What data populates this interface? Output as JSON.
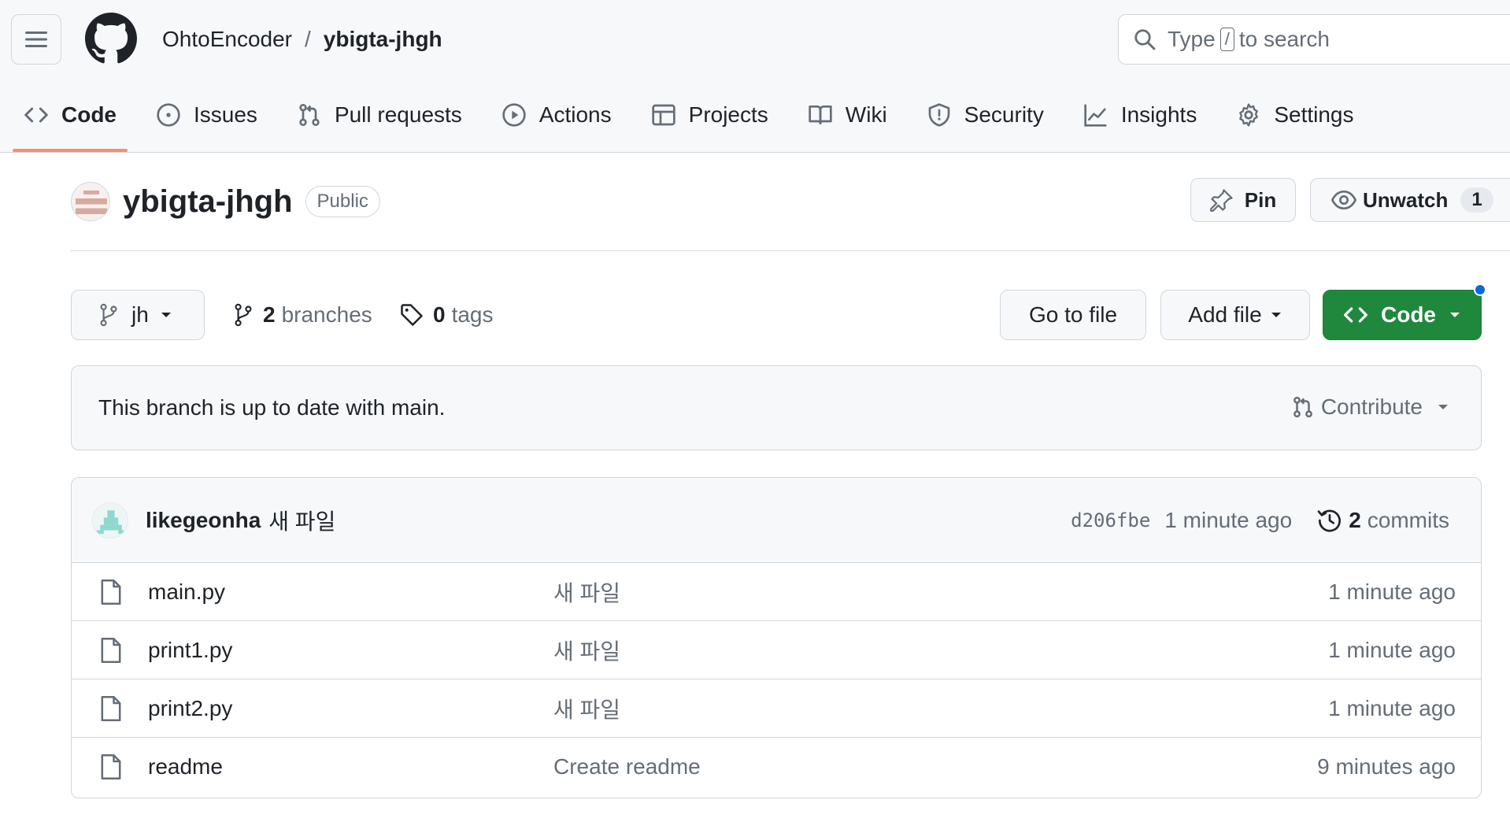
{
  "header": {
    "owner": "OhtoEncoder",
    "separator": "/",
    "repo": "ybigta-jhgh",
    "search": {
      "before": "Type",
      "key": "/",
      "after": "to search"
    }
  },
  "tabs": [
    {
      "label": "Code",
      "icon": "code-icon",
      "active": true
    },
    {
      "label": "Issues",
      "icon": "issue-opened-icon"
    },
    {
      "label": "Pull requests",
      "icon": "git-pull-request-icon"
    },
    {
      "label": "Actions",
      "icon": "play-icon"
    },
    {
      "label": "Projects",
      "icon": "table-icon"
    },
    {
      "label": "Wiki",
      "icon": "book-icon"
    },
    {
      "label": "Security",
      "icon": "shield-icon"
    },
    {
      "label": "Insights",
      "icon": "graph-icon"
    },
    {
      "label": "Settings",
      "icon": "gear-icon"
    }
  ],
  "repo": {
    "title": "ybigta-jhgh",
    "visibility": "Public",
    "pin_label": "Pin",
    "watch_label": "Unwatch",
    "watch_count": "1"
  },
  "branch_bar": {
    "current_branch": "jh",
    "branches_count": "2",
    "branches_label": "branches",
    "tags_count": "0",
    "tags_label": "tags",
    "go_to_file": "Go to file",
    "add_file": "Add file",
    "code_label": "Code"
  },
  "flash": {
    "message": "This branch is up to date with main.",
    "contribute_label": "Contribute"
  },
  "latest_commit": {
    "author": "likegeonha",
    "message": "새 파일",
    "sha": "d206fbe",
    "time": "1 minute ago",
    "commits_count": "2",
    "commits_label": "commits"
  },
  "files": [
    {
      "name": "main.py",
      "message": "새 파일",
      "time": "1 minute ago"
    },
    {
      "name": "print1.py",
      "message": "새 파일",
      "time": "1 minute ago"
    },
    {
      "name": "print2.py",
      "message": "새 파일",
      "time": "1 minute ago"
    },
    {
      "name": "readme",
      "message": "Create readme",
      "time": "9 minutes ago"
    }
  ],
  "colors": {
    "accent_underline": "#fd8c73",
    "primary_button": "#1f883d",
    "notification_dot": "#0969da"
  }
}
